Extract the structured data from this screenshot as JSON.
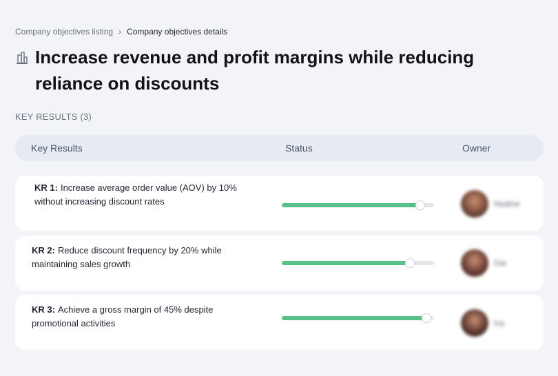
{
  "breadcrumb": {
    "parent": "Company objectives listing",
    "separator": "›",
    "current": "Company objectives details"
  },
  "objective": {
    "icon": "building-icon",
    "title": "Increase revenue and profit margins while reducing reliance on discounts"
  },
  "key_results_label": "KEY RESULTS (3)",
  "table": {
    "columns": [
      "Key Results",
      "Status",
      "Owner"
    ]
  },
  "key_results": [
    {
      "num": "KR 1:",
      "text": "Increase average order value (AOV) by 10% without increasing discount rates",
      "progress": 0.91,
      "owner": "Nadine",
      "avatar_color": "#7a4a3a"
    },
    {
      "num": "KR 2:",
      "text": "Reduce discount frequency by 20% while maintaining sales growth",
      "progress": 0.84,
      "owner": "Dai",
      "avatar_color": "#6b3f35"
    },
    {
      "num": "KR 3:",
      "text": "Achieve a gross margin of 45% despite promotional activities",
      "progress": 0.95,
      "owner": "Ivy",
      "avatar_color": "#5e3b30"
    }
  ],
  "colors": {
    "progress_fill": "#58c18b",
    "progress_track": "#e5e7eb",
    "header_bg": "#e6eaf2",
    "page_bg": "#f3f4f7"
  }
}
